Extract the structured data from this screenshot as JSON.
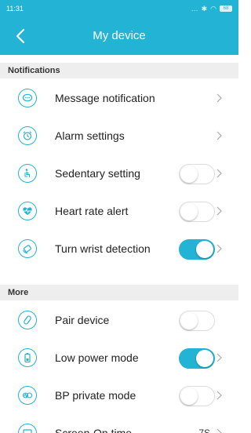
{
  "status_bar": {
    "time": "11:31",
    "battery": "68"
  },
  "header": {
    "title": "My device"
  },
  "colors": {
    "accent": "#22b3d5",
    "section_bg": "#eeeeee"
  },
  "sections": [
    {
      "title": "Notifications",
      "items": [
        {
          "label": "Message notification",
          "icon": "message-icon",
          "control": "chevron"
        },
        {
          "label": "Alarm settings",
          "icon": "alarm-clock-icon",
          "control": "chevron"
        },
        {
          "label": "Sedentary setting",
          "icon": "sedentary-icon",
          "control": "toggle",
          "on": false
        },
        {
          "label": "Heart rate alert",
          "icon": "heart-rate-icon",
          "control": "toggle",
          "on": false
        },
        {
          "label": "Turn wrist detection",
          "icon": "wrist-icon",
          "control": "toggle",
          "on": true
        }
      ]
    },
    {
      "title": "More",
      "items": [
        {
          "label": "Pair device",
          "icon": "link-icon",
          "control": "toggle",
          "on": false
        },
        {
          "label": "Low power mode",
          "icon": "battery-icon",
          "control": "toggle",
          "on": true
        },
        {
          "label": "BP private mode",
          "icon": "blood-pressure-icon",
          "control": "toggle",
          "on": false
        },
        {
          "label": "Screen-On time",
          "icon": "screen-icon",
          "control": "value",
          "value": "7S"
        }
      ]
    }
  ]
}
